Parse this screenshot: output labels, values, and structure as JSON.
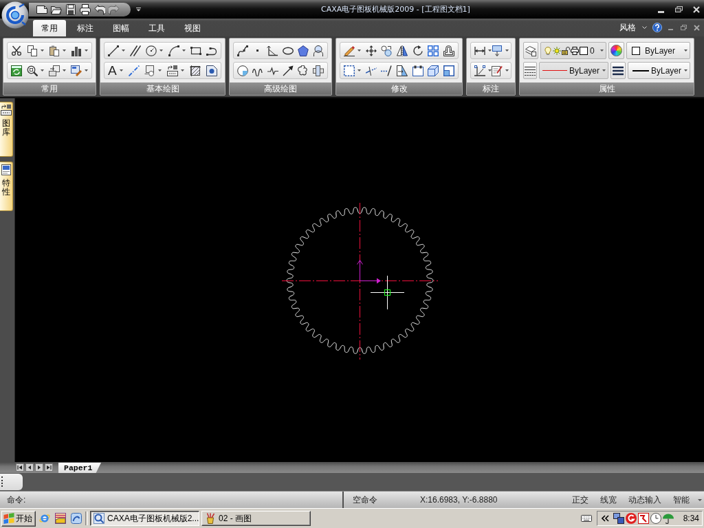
{
  "window": {
    "title": "CAXA电子图板机械版2009 - [工程图文档1]"
  },
  "quick_access": [
    {
      "disabled": false
    },
    {
      "disabled": false
    },
    {
      "disabled": false
    },
    {
      "disabled": false
    },
    {
      "disabled": false
    },
    {
      "disabled": true
    }
  ],
  "tabs": [
    {
      "label": "常用",
      "selected": true
    },
    {
      "label": "标注",
      "selected": false
    },
    {
      "label": "图幅",
      "selected": false
    },
    {
      "label": "工具",
      "selected": false
    },
    {
      "label": "视图",
      "selected": false
    }
  ],
  "style_menu": {
    "label": "风格"
  },
  "ribbon": {
    "groups": [
      {
        "label": "常用",
        "kind": "tools"
      },
      {
        "label": "基本绘图",
        "kind": "tools",
        "text_glyph": "A"
      },
      {
        "label": "高级绘图",
        "kind": "tools"
      },
      {
        "label": "修改",
        "kind": "tools"
      },
      {
        "label": "标注",
        "kind": "tools"
      },
      {
        "label": "属性",
        "kind": "properties",
        "layer": "0",
        "color_choice": "ByLayer",
        "linetype": "ByLayer",
        "lineweight": "ByLayer"
      }
    ]
  },
  "side_dock": {
    "tabs": [
      {
        "label": "图库"
      },
      {
        "label": "特性"
      }
    ]
  },
  "sheet_tabs": [
    {
      "label": "Paper1",
      "selected": true
    }
  ],
  "command_line": {
    "prompt": "命令:"
  },
  "status_bar": {
    "command": "空命令",
    "coordinates": "X:16.6983, Y:-6.8880",
    "toggles": [
      {
        "label": "正交"
      },
      {
        "label": "线宽"
      },
      {
        "label": "动态输入"
      },
      {
        "label": "智能"
      }
    ]
  },
  "taskbar": {
    "start": "开始",
    "tasks": [
      {
        "label": "CAXA电子图板机械版2...",
        "selected": true
      },
      {
        "label": "02 - 画图",
        "selected": false
      }
    ],
    "clock": "8:34"
  }
}
